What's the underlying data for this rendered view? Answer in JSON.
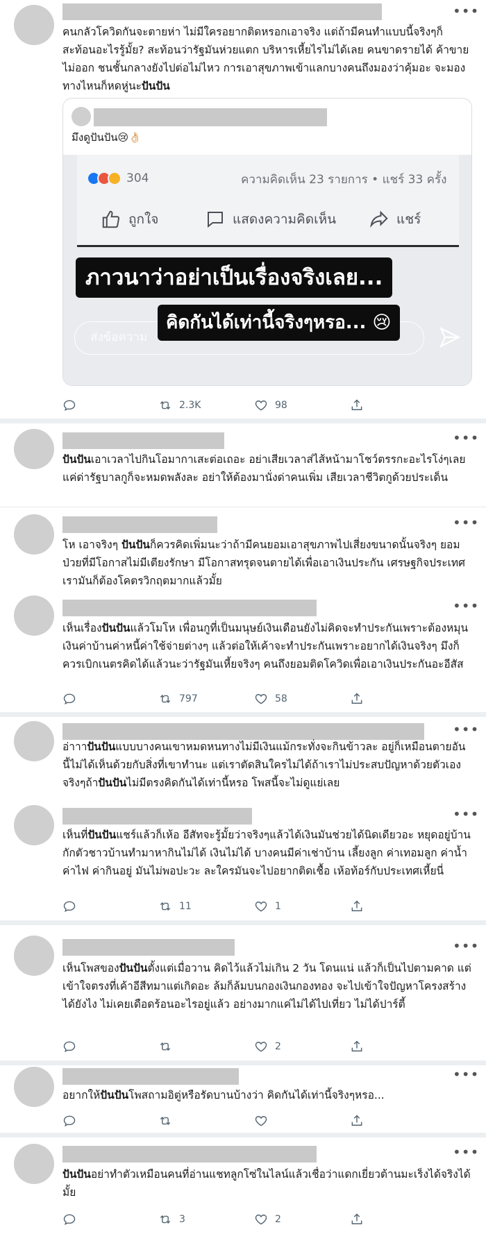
{
  "posts": [
    {
      "text_html": "คนกลัวโควิดกันจะตายห่า ไม่มีใครอยากติดหรอกเอาจริง แต่ถ้ามีคนทำแบบนี้จริงๆก็สะท้อนอะไรรู้มั้ย? สะท้อนว่ารัฐมันห่วยแตก บริหารเหี้ยไรไม่ได้เลย คนขาดรายได้ ค้าขายไม่ออก ชนชั้นกลางยังไปต่อไม่ไหว การเอาสุขภาพเข้าแลกบางคนถึงมองว่าคุ้มอะ จะมองทางไหนก็หดหู่นะ<b>ปันปัน</b>",
      "quote": {
        "text": "มึงดูปันปัน😢👌🏻",
        "fb_reaction_count": "304",
        "fb_comments": "ความคิดเห็น 23 รายการ • แชร์ 33 ครั้ง",
        "fb_like": "ถูกใจ",
        "fb_comment": "แสดงความคิดเห็น",
        "fb_share": "แชร์",
        "caption1": "ภาวนาว่าอย่าเป็นเรื่องจริงเลย...",
        "caption2": "คิดกันได้เท่านี้จริงๆหรอ... 😢",
        "message_placeholder": "ส่งข้อความ"
      },
      "actions": {
        "reply": "",
        "retweet": "2.3K",
        "like": "98"
      }
    },
    {
      "text_html": "<b>ปันปัน</b>เอาเวลาไปกินโอมากาเสะต่อเถอะ อย่าเสียเวลาส่ไส้หน้ามาโชว์ตรรกะอะไรโง่ๆเลย แค่ด่ารัฐบาลกูก็จะหมดพลังละ อย่าให้ต้องมานั่งด่าคนเพิ่ม เสียเวลาชีวิตกูด้วยประเด็น"
    },
    {
      "text_html": "โห เอาจริงๆ <b>ปันปัน</b>ก็ควรคิดเพิ่มนะว่าถ้ามีคนยอมเอาสุขภาพไปเสี่ยงขนาดนั้นจริงๆ ยอมป่วยที่มีโอกาสไม่มีเตียงรักษา มีโอกาสทรุดจนตายได้เพื่อเอาเงินประกัน เศรษฐกิจประเทศเรามันก็ต้องโคตรวิกฤตมากแล้วมั้ย"
    },
    {
      "text_html": "เห็นเรื่อง<b>ปันปัน</b>แล้วโมโห เพื่อนกูที่เป็นมนุษย์เงินเดือนยังไม่คิดจะทำประกันเพราะต้องหมุนเงินค่าบ้านค่าหนี้ค่าใช้จ่ายต่างๆ แล้วต่อให้เค้าจะทำประกันเพราะอยากได้เงินจริงๆ มึงก็ควรเบิกเนตรคิดได้แล้วนะว่ารัฐมันเหี้ยจริงๆ คนถึงยอมติดโควิดเพื่อเอาเงินประกันอะอีสัส",
      "actions": {
        "reply": "",
        "retweet": "797",
        "like": "58"
      }
    },
    {
      "text_html": "อ่าาา<b>ปันปัน</b>แบบบางคนเขาหมดหนทางไม่มีเงินแม้กระทั่งจะกินข้าวละ อยู่ก็เหมือนตายอันนี้ไม่ได้เห็นด้วยกับสิ่งที่เขาทำนะ แต่เราตัดสินใครไม่ได้ถ้าเราไม่ประสบปัญหาด้วยตัวเอง จริงๆถ้า<b>ปันปัน</b>ไม่มีตรงคิดกันได้เท่านี้หรอ โพสนี้จะไม่ดูแย่เลย"
    },
    {
      "text_html": "เห็นที่<b>ปันปัน</b>แชร์แล้วก็เห้อ อีสัทจะรู้มั้ยว่าจริงๆแล้วได้เงินมันช่วยได้นิดเดียวอะ หยุดอยู่บ้านกักตัวชาวบ้านทำมาหากินไม่ได้ เงินไม่ได้ บางคนมีค่าเช่าบ้าน เลี้ยงลูก ค่าเทอมลูก ค่าน้ำ ค่าไฟ ค่ากินอยู่ มันไม่พอปะวะ ละใครมันจะไปอยากติดเชื้อ เห้อท้อร์กับประเทศเหี้ยนี่",
      "actions": {
        "reply": "",
        "retweet": "11",
        "like": "1"
      }
    },
    {
      "text_html": "เห็นโพสของ<b>ปันปัน</b>ตั้งแต่เมื่อวาน คิดไว้แล้วไม่เกิน 2 วัน โดนแน่ แล้วก็เป็นไปตามคาด แต่เข้าใจตรงที่เค้าอีสีทมาแต่เกิดอะ ล้มก็ล้มบนกองเงินกองทอง จะไปเข้าใจปัญหาโครงสร้างได้ยังไง ไม่เคยเดือดร้อนอะไรอยู่แล้ว อย่างมากแค่ไม่ได้ไปเที่ยว ไม่ได้ปาร์ตี้",
      "actions": {
        "reply": "",
        "retweet": "",
        "like": "2"
      }
    },
    {
      "text_html": "อยากให้<b>ปันปัน</b>โพสถามอิตู่หรือรัดบานบ้างว่า คิดกันได้เท่านี้จริงๆหรอ...",
      "actions": {
        "reply": "",
        "retweet": "",
        "like": ""
      }
    },
    {
      "text_html": "<b>ปันปัน</b>อย่าทำตัวเหมือนคนที่อ่านแชทลูกโซ่ในไลน์แล้วเชื่อว่าแดกเยี่ยวต้านมะเร็งได้จริงได้มั้ย",
      "actions": {
        "reply": "",
        "retweet": "3",
        "like": "2"
      }
    }
  ],
  "icons": {
    "reply": "reply-icon",
    "retweet": "retweet-icon",
    "like": "heart-icon",
    "share": "share-icon",
    "more": "more-dots-icon"
  },
  "colors": {
    "action_gray": "#536471",
    "placeholder_gray": "#c9c9c9",
    "separator": "#eceff1",
    "fb_blue": "#1877f2"
  }
}
